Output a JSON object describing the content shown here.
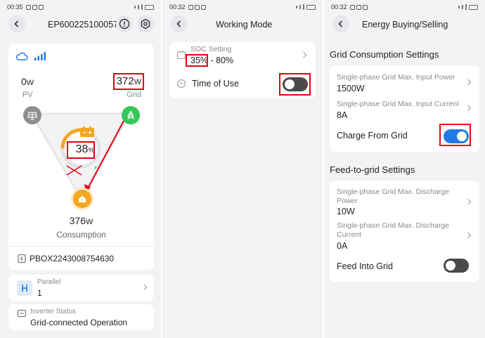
{
  "panel1": {
    "status_time": "00:35",
    "header_title": "EP60022510005​7...",
    "pv_value": "0",
    "pv_unit": "W",
    "pv_label": "PV",
    "grid_value": "372",
    "grid_unit": "W",
    "grid_label": "Grid",
    "battery_value": "38",
    "battery_unit": "%",
    "consumption_value": "376",
    "consumption_unit": "W",
    "consumption_label": "Consumption",
    "device_serial": "PBOX2243008754630",
    "parallel_label": "Parallel",
    "parallel_value": "1",
    "inverter_status_label": "Inverter Status",
    "inverter_status_value": "Grid-connected Operation"
  },
  "panel2": {
    "status_time": "00:32",
    "header_title": "Working Mode",
    "soc_label": "SOC Setting",
    "soc_low": "35%",
    "soc_sep": " - ",
    "soc_high": "80%",
    "tou_label": "Time of Use",
    "tou_enabled": false
  },
  "panel3": {
    "status_time": "00:32",
    "header_title": "Energy Buying/Selling",
    "grid_section": "Grid Consumption Settings",
    "max_input_power_label": "Single-phase Grid Max. Input Power",
    "max_input_power_value": "1500W",
    "max_input_current_label": "Single-phase Grid Max. Input Current",
    "max_input_current_value": "8A",
    "charge_from_grid_label": "Charge From Grid",
    "charge_from_grid_enabled": true,
    "feed_section": "Feed-to-grid Settings",
    "max_discharge_power_label_1": "Single-phase Grid Max. Discharge",
    "max_discharge_power_label_2": "Power",
    "max_discharge_power_value": "10W",
    "max_discharge_current_label_1": "Single-phase Grid Max. Discharge",
    "max_discharge_current_label_2": "Current",
    "max_discharge_current_value": "0A",
    "feed_into_grid_label": "Feed Into Grid",
    "feed_into_grid_enabled": false
  },
  "colors": {
    "accent_blue": "#1f7be6",
    "grid_green": "#34c759",
    "battery_orange": "#f5a623",
    "highlight_red": "#e60012",
    "toggle_off": "#4a4a4a"
  },
  "icons": {
    "back": "chevron-left-icon",
    "alert": "exclamation-circle-icon",
    "settings": "gear-icon",
    "cloud": "cloud-icon",
    "signal": "signal-bars-icon",
    "solar": "solar-panel-icon",
    "tower": "grid-tower-icon",
    "battery": "battery-icon",
    "home": "home-icon",
    "device": "device-icon",
    "parallel": "parallel-icon",
    "inverter": "inverter-icon",
    "soc": "battery-outline-icon",
    "clock": "clock-icon"
  }
}
